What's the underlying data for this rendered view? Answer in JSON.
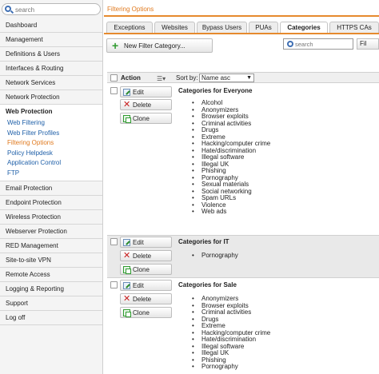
{
  "sidebar": {
    "search_placeholder": "search",
    "top_items": [
      {
        "label": "Dashboard"
      },
      {
        "label": "Management"
      },
      {
        "label": "Definitions & Users"
      },
      {
        "label": "Interfaces & Routing"
      },
      {
        "label": "Network Services"
      },
      {
        "label": "Network Protection"
      }
    ],
    "group": {
      "title": "Web Protection",
      "subs": [
        {
          "label": "Web Filtering"
        },
        {
          "label": "Web Filter Profiles"
        },
        {
          "label": "Filtering Options"
        },
        {
          "label": "Policy Helpdesk"
        },
        {
          "label": "Application Control"
        },
        {
          "label": "FTP"
        }
      ]
    },
    "bottom_items": [
      {
        "label": "Email Protection"
      },
      {
        "label": "Endpoint Protection"
      },
      {
        "label": "Wireless Protection"
      },
      {
        "label": "Webserver Protection"
      },
      {
        "label": "RED Management"
      },
      {
        "label": "Site-to-site VPN"
      },
      {
        "label": "Remote Access"
      },
      {
        "label": "Logging & Reporting"
      },
      {
        "label": "Support"
      },
      {
        "label": "Log off"
      }
    ]
  },
  "page": {
    "title": "Filtering Options",
    "tabs": [
      {
        "label": "Exceptions"
      },
      {
        "label": "Websites"
      },
      {
        "label": "Bypass Users"
      },
      {
        "label": "PUAs"
      },
      {
        "label": "Categories"
      },
      {
        "label": "HTTPS CAs"
      }
    ],
    "new_button": "New Filter Category...",
    "filter_placeholder": "search",
    "filter_button": "Fil",
    "list_header": {
      "action": "Action",
      "sort_by": "Sort by:",
      "sort_value": "Name asc"
    },
    "actions": {
      "edit": "Edit",
      "delete": "Delete",
      "clone": "Clone"
    },
    "categories": [
      {
        "name": "Categories for Everyone",
        "items": [
          "Alcohol",
          "Anonymizers",
          "Browser exploits",
          "Criminal activities",
          "Drugs",
          "Extreme",
          "Hacking/computer crime",
          "Hate/discrimination",
          "Illegal software",
          "Illegal UK",
          "Phishing",
          "Pornography",
          "Sexual materials",
          "Social networking",
          "Spam URLs",
          "Violence",
          "Web ads"
        ]
      },
      {
        "name": "Categories for IT",
        "items": [
          "Pornography"
        ]
      },
      {
        "name": "Categories for Sale",
        "items": [
          "Anonymizers",
          "Browser exploits",
          "Criminal activities",
          "Drugs",
          "Extreme",
          "Hacking/computer crime",
          "Hate/discrimination",
          "Illegal software",
          "Illegal UK",
          "Phishing",
          "Pornography"
        ]
      }
    ]
  }
}
